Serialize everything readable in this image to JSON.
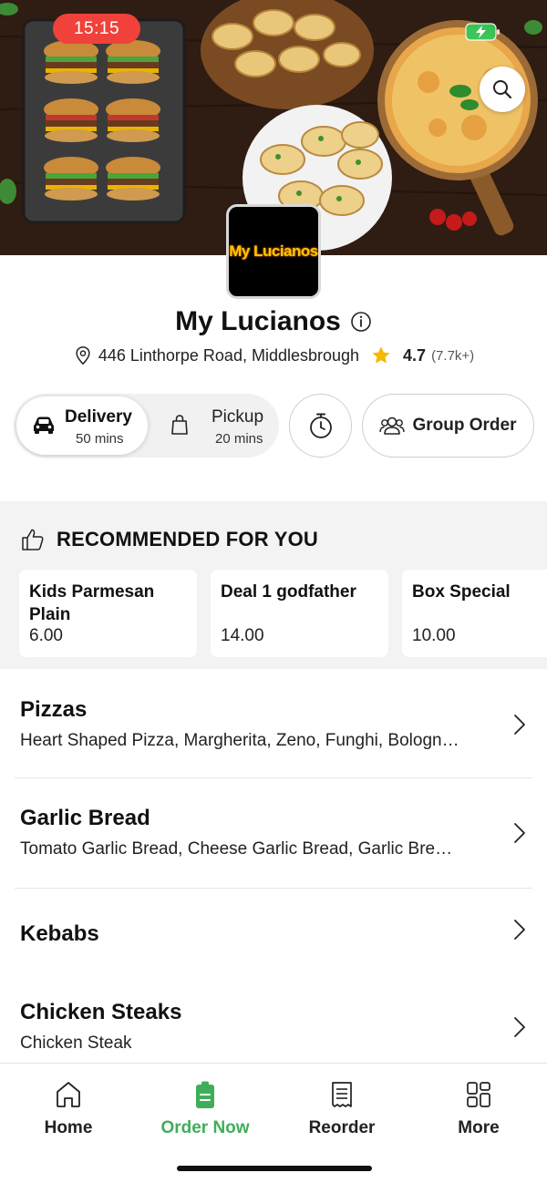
{
  "status_bar": {
    "time": "15:15"
  },
  "restaurant": {
    "name": "My Lucianos",
    "logo_text": "My Lucianos",
    "address": "446 Linthorpe Road, Middlesbrough",
    "rating": "4.7",
    "reviews": "(7.7k+)"
  },
  "mode": {
    "delivery": {
      "label": "Delivery",
      "time": "50 mins",
      "selected": true
    },
    "pickup": {
      "label": "Pickup",
      "time": "20 mins",
      "selected": false
    },
    "group_order_label": "Group Order"
  },
  "recommended": {
    "title": "RECOMMENDED FOR YOU",
    "items": [
      {
        "name": "Kids Parmesan Plain",
        "price": "6.00"
      },
      {
        "name": "Deal 1 godfather",
        "price": "14.00"
      },
      {
        "name": "Box Special",
        "price": "10.00"
      }
    ]
  },
  "categories": [
    {
      "name": "Pizzas",
      "description": "Heart Shaped Pizza, Margherita, Zeno, Funghi, Bologn…"
    },
    {
      "name": "Garlic Bread",
      "description": "Tomato Garlic Bread, Cheese Garlic Bread, Garlic Bre…"
    },
    {
      "name": "Kebabs",
      "description": ""
    },
    {
      "name": "Chicken Steaks",
      "description": "Chicken Steak"
    }
  ],
  "bottom_nav": {
    "items": [
      {
        "label": "Home",
        "icon": "home-icon"
      },
      {
        "label": "Order Now",
        "icon": "order-icon",
        "active": true
      },
      {
        "label": "Reorder",
        "icon": "receipt-icon"
      },
      {
        "label": "More",
        "icon": "grid-icon"
      }
    ]
  },
  "colors": {
    "accent_green": "#3fae5a",
    "time_pill_red": "#f0413b",
    "star_yellow": "#f5b800",
    "battery_green": "#35c759"
  }
}
